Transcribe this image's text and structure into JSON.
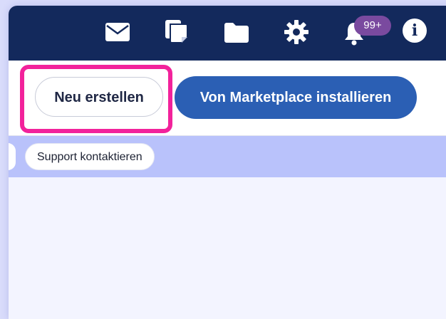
{
  "topbar": {
    "icons": [
      "mail-icon",
      "notes-icon",
      "folder-icon",
      "gear-icon",
      "bell-icon",
      "info-icon"
    ],
    "notification_count": "99+",
    "info_glyph": "i"
  },
  "toolbar": {
    "new_label": "Neu erstellen",
    "marketplace_label": "Von Marketplace installieren"
  },
  "chips": {
    "support_label": "Support kontaktieren"
  },
  "colors": {
    "topbar_bg": "#13295c",
    "primary_button": "#2b5fb4",
    "highlight": "#f2229b",
    "badge": "#7a4a9f",
    "chipbar_bg": "#b9c2fb"
  }
}
